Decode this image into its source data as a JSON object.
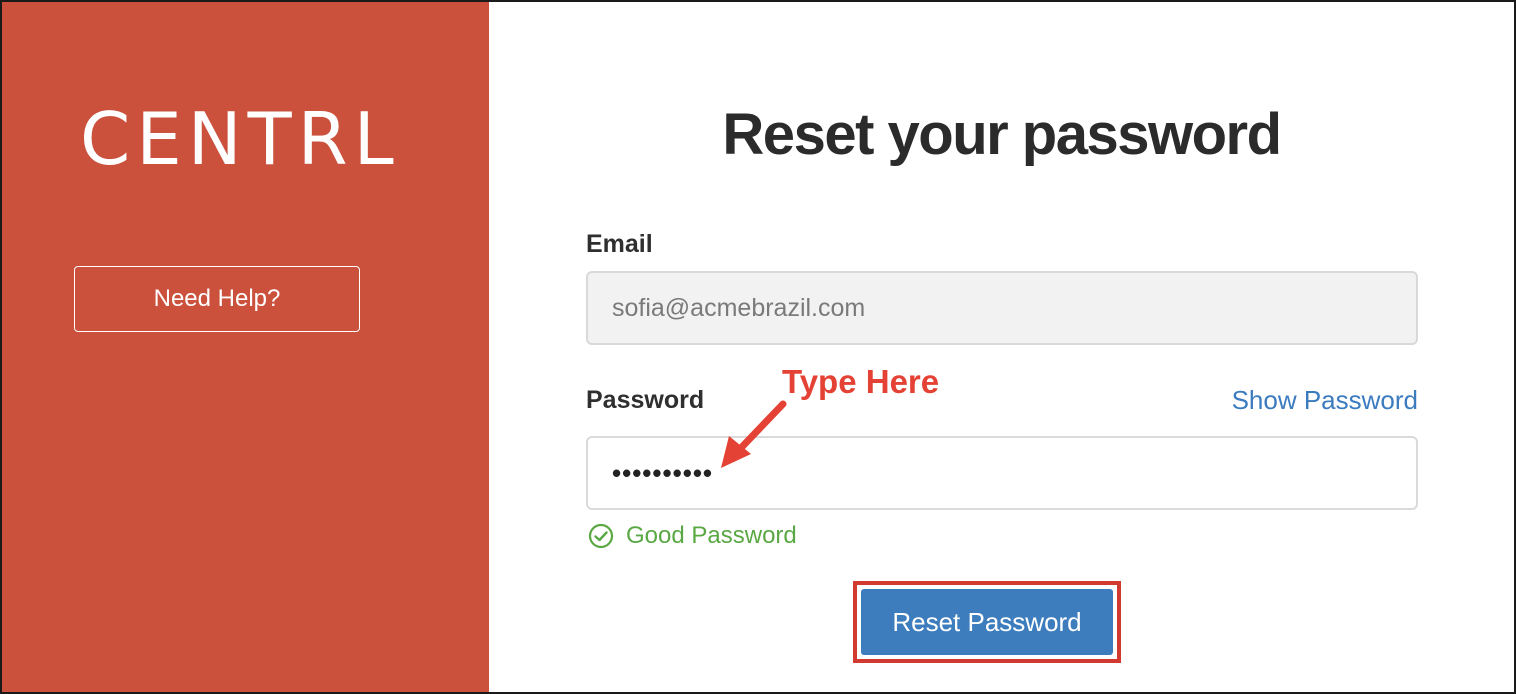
{
  "brand": {
    "logo_text": "CENTRL"
  },
  "sidebar": {
    "help_label": "Need Help?"
  },
  "form": {
    "title": "Reset your password",
    "email_label": "Email",
    "email_value": "sofia@acmebrazil.com",
    "password_label": "Password",
    "show_password_label": "Show Password",
    "password_value": "••••••••••",
    "strength_text": "Good Password",
    "submit_label": "Reset Password"
  },
  "annotation": {
    "callout_text": "Type Here"
  },
  "icons": {
    "strength": "check-circle-icon",
    "callout": "arrow-icon"
  },
  "colors": {
    "sidebar_bg": "#cb513d",
    "primary_button": "#3d7dbd",
    "link": "#3b7bbf",
    "success": "#5aa844",
    "annotation": "#e34234"
  }
}
